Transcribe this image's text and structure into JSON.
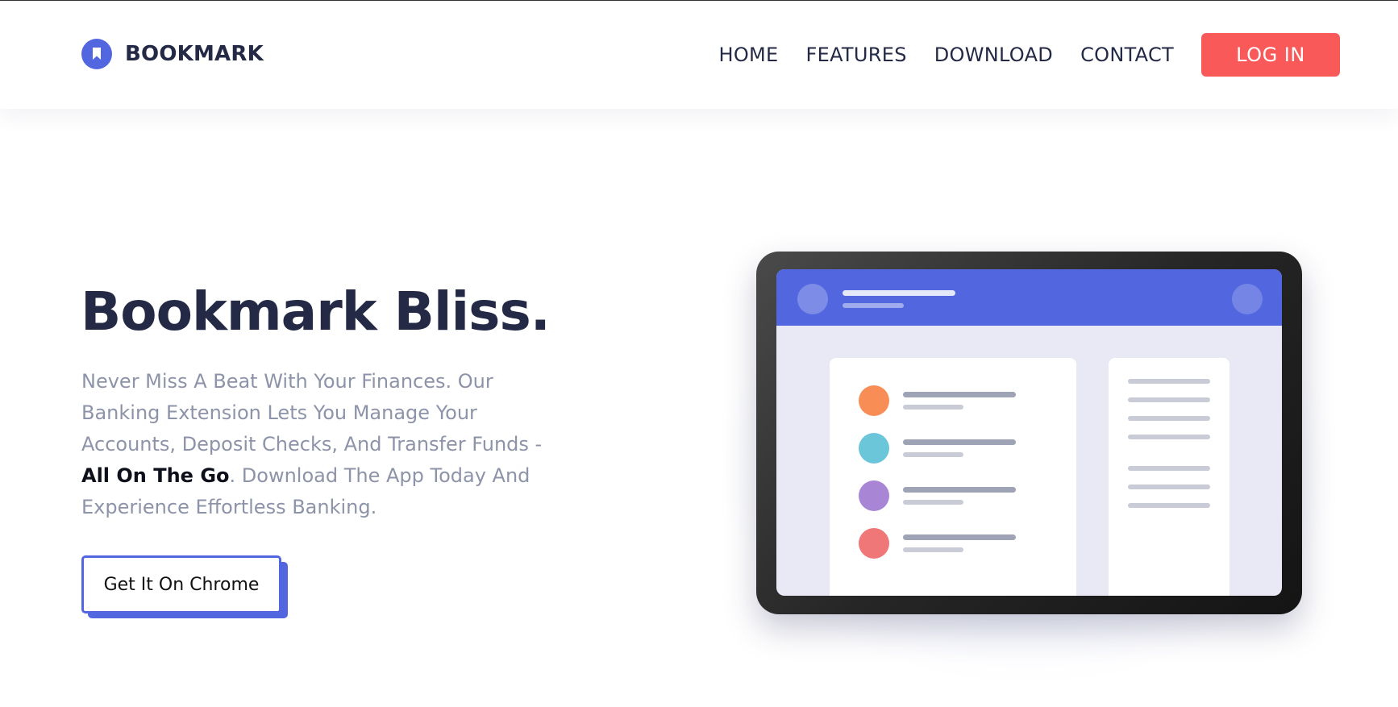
{
  "header": {
    "brand": "BOOKMARK",
    "nav": {
      "home": "HOME",
      "features": "FEATURES",
      "download": "DOWNLOAD",
      "contact": "CONTACT"
    },
    "login_label": "LOG IN"
  },
  "hero": {
    "title": "Bookmark Bliss.",
    "text_before": "Never Miss A Beat With Your Finances. Our Banking Extension Lets You Manage Your Accounts, Deposit Checks, And Transfer Funds - ",
    "text_bold": "All On The Go",
    "text_after": ". Download The App Today And Experience Effortless Banking.",
    "cta_label": "Get It On Chrome"
  },
  "illustration": {
    "dot_colors": [
      "#f98d56",
      "#6bc6d9",
      "#a985d6",
      "#ef7777"
    ],
    "accent": "#5267df"
  },
  "colors": {
    "brand": "#5267df",
    "login": "#fa5959",
    "heading": "#242a45",
    "body_text": "#8d93a8"
  },
  "icons": {
    "logo": "bookmark-icon"
  }
}
